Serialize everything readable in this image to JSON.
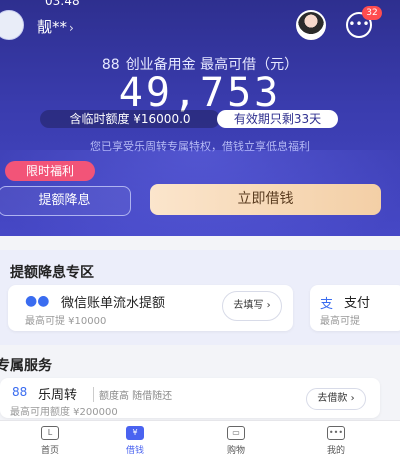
{
  "status_bar": {
    "time": "03:48"
  },
  "user": {
    "name": "靓**",
    "chevron": "›"
  },
  "messages": {
    "badge": "32"
  },
  "hero": {
    "product_glyph": "88",
    "product_text": "创业备用金 最高可借（元）",
    "amount": "49,753",
    "temp_quota": "含临时额度 ¥16000.0",
    "validity": "有效期只剩33天",
    "notice": "您已享受乐周转专属特权，借钱立享低息福利",
    "promo_tag": "限时福利",
    "raise_button": "提额降息",
    "borrow_button": "立即借钱"
  },
  "section_raise": {
    "title": "提额降息专区",
    "cards": [
      {
        "icon": "wechat-icon",
        "title": "微信账单流水提额",
        "sub": "最高可提   ¥10000",
        "button": "去填写 ›"
      },
      {
        "icon": "alipay-icon",
        "title": "支付",
        "sub": "最高可提"
      }
    ]
  },
  "section_service": {
    "title": "专属服务",
    "card": {
      "glyph": "88",
      "title": "乐周转",
      "desc": "额度高 随借随还",
      "sub": "最高可用额度 ¥200000",
      "button": "去借款 ›"
    }
  },
  "tabs": [
    {
      "label": "首页",
      "glyph": "L"
    },
    {
      "label": "借钱",
      "glyph": "¥"
    },
    {
      "label": "购物",
      "glyph": "▭"
    },
    {
      "label": "我的",
      "glyph": "•••"
    }
  ],
  "colors": {
    "hero_dark": "#2e2f8f",
    "hero_light": "#4648c6",
    "accent": "#4a63f0",
    "promo": "#f25478",
    "borrow_btn": "#f3cfa6"
  }
}
